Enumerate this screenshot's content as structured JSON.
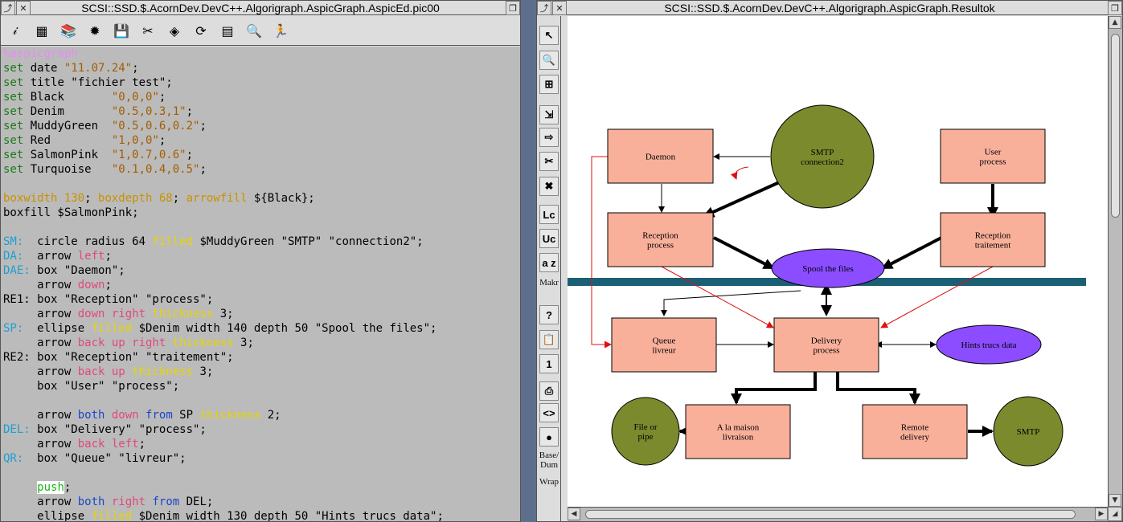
{
  "editor": {
    "title": "SCSI::SSD.$.AcornDev.DevC++.Algorigraph.AspicGraph.AspicEd.pic00",
    "toolbar": [
      {
        "name": "info-icon",
        "glyph": "𝒾"
      },
      {
        "name": "film-icon",
        "glyph": "▦"
      },
      {
        "name": "books-icon",
        "glyph": "📚"
      },
      {
        "name": "gear-icon",
        "glyph": "✹"
      },
      {
        "name": "save-icon",
        "glyph": "💾"
      },
      {
        "name": "pin-icon",
        "glyph": "✂"
      },
      {
        "name": "diamond-icon",
        "glyph": "◈"
      },
      {
        "name": "refresh-icon",
        "glyph": "⟳"
      },
      {
        "name": "chart-icon",
        "glyph": "▤"
      },
      {
        "name": "find-icon",
        "glyph": "🔍"
      },
      {
        "name": "run-icon",
        "glyph": "🏃"
      }
    ],
    "code": [
      [
        [
          "k-head",
          "%aspicgraph"
        ]
      ],
      [
        [
          "k-set",
          "set"
        ],
        [
          "",
          " date "
        ],
        [
          "k-str",
          "\"11.07.24\""
        ],
        [
          "",
          ";"
        ]
      ],
      [
        [
          "k-set",
          "set"
        ],
        [
          "",
          " title \"fichier test\";"
        ]
      ],
      [
        [
          "k-set",
          "set"
        ],
        [
          "",
          " Black       "
        ],
        [
          "k-str",
          "\"0,0,0\""
        ],
        [
          "",
          ";"
        ]
      ],
      [
        [
          "k-set",
          "set"
        ],
        [
          "",
          " Denim       "
        ],
        [
          "k-str",
          "\"0.5,0.3,1\""
        ],
        [
          "",
          ";"
        ]
      ],
      [
        [
          "k-set",
          "set"
        ],
        [
          "",
          " MuddyGreen  "
        ],
        [
          "k-str",
          "\"0.5,0.6,0.2\""
        ],
        [
          "",
          ";"
        ]
      ],
      [
        [
          "k-set",
          "set"
        ],
        [
          "",
          " Red         "
        ],
        [
          "k-str",
          "\"1,0,0\""
        ],
        [
          "",
          ";"
        ]
      ],
      [
        [
          "k-set",
          "set"
        ],
        [
          "",
          " SalmonPink  "
        ],
        [
          "k-str",
          "\"1,0.7,0.6\""
        ],
        [
          "",
          ";"
        ]
      ],
      [
        [
          "k-set",
          "set"
        ],
        [
          "",
          " Turquoise   "
        ],
        [
          "k-str",
          "\"0.1,0.4,0.5\""
        ],
        [
          "",
          ";"
        ]
      ],
      [
        [
          "",
          ""
        ]
      ],
      [
        [
          "k-num",
          "boxwidth 130"
        ],
        [
          "",
          "; "
        ],
        [
          "k-num",
          "boxdepth 68"
        ],
        [
          "",
          "; "
        ],
        [
          "k-num",
          "arrowfill"
        ],
        [
          "",
          " ${Black};"
        ]
      ],
      [
        [
          "",
          "boxfill $SalmonPink;"
        ]
      ],
      [
        [
          "",
          ""
        ]
      ],
      [
        [
          "k-lab",
          "SM:"
        ],
        [
          "",
          "  circle radius 64 "
        ],
        [
          "k-fil",
          "filled"
        ],
        [
          "",
          " $MuddyGreen \"SMTP\" \"connection2\";"
        ]
      ],
      [
        [
          "k-lab",
          "DA:"
        ],
        [
          "",
          "  arrow "
        ],
        [
          "k-dir",
          "left"
        ],
        [
          "",
          ";"
        ]
      ],
      [
        [
          "k-lab",
          "DAE:"
        ],
        [
          "",
          " box \"Daemon\";"
        ]
      ],
      [
        [
          "",
          "     arrow "
        ],
        [
          "k-dir",
          "down"
        ],
        [
          "",
          ";"
        ]
      ],
      [
        [
          "",
          "RE1: box \"Reception\" \"process\";"
        ]
      ],
      [
        [
          "",
          "     arrow "
        ],
        [
          "k-dir",
          "down right"
        ],
        [
          "",
          " "
        ],
        [
          "k-fil",
          "thickness"
        ],
        [
          "",
          " 3;"
        ]
      ],
      [
        [
          "k-lab",
          "SP:"
        ],
        [
          "",
          "  ellipse "
        ],
        [
          "k-fil",
          "filled"
        ],
        [
          "",
          " $Denim width 140 depth 50 \"Spool the files\";"
        ]
      ],
      [
        [
          "",
          "     arrow "
        ],
        [
          "k-dir",
          "back up right"
        ],
        [
          "",
          " "
        ],
        [
          "k-fil",
          "thickness"
        ],
        [
          "",
          " 3;"
        ]
      ],
      [
        [
          "",
          "RE2: box \"Reception\" \"traitement\";"
        ]
      ],
      [
        [
          "",
          "     arrow "
        ],
        [
          "k-dir",
          "back up"
        ],
        [
          "",
          " "
        ],
        [
          "k-fil",
          "thickness"
        ],
        [
          "",
          " 3;"
        ]
      ],
      [
        [
          "",
          "     box \"User\" \"process\";"
        ]
      ],
      [
        [
          "",
          ""
        ]
      ],
      [
        [
          "",
          "     arrow "
        ],
        [
          "k-kw",
          "both"
        ],
        [
          "",
          " "
        ],
        [
          "k-dir",
          "down"
        ],
        [
          "",
          " "
        ],
        [
          "k-kw",
          "from"
        ],
        [
          "",
          " SP "
        ],
        [
          "k-fil",
          "thickness"
        ],
        [
          "",
          " 2;"
        ]
      ],
      [
        [
          "k-lab",
          "DEL:"
        ],
        [
          "",
          " box \"Delivery\" \"process\";"
        ]
      ],
      [
        [
          "",
          "     arrow "
        ],
        [
          "k-dir",
          "back left"
        ],
        [
          "",
          ";"
        ]
      ],
      [
        [
          "k-lab",
          "QR:"
        ],
        [
          "",
          "  box \"Queue\" \"livreur\";"
        ]
      ],
      [
        [
          "",
          ""
        ]
      ],
      [
        [
          "",
          "     "
        ],
        [
          "k-push",
          "push"
        ],
        [
          "",
          ";"
        ]
      ],
      [
        [
          "",
          "     arrow "
        ],
        [
          "k-kw",
          "both"
        ],
        [
          "",
          " "
        ],
        [
          "k-dir",
          "right"
        ],
        [
          "",
          " "
        ],
        [
          "k-kw",
          "from"
        ],
        [
          "",
          " DEL;"
        ]
      ],
      [
        [
          "",
          "     ellipse "
        ],
        [
          "k-fil",
          "filled"
        ],
        [
          "",
          " $Denim width 130 depth 50 \"Hints trucs data\";"
        ]
      ]
    ]
  },
  "result": {
    "title": "SCSI::SSD.$.AcornDev.DevC++.Algorigraph.AspicGraph.Resultok",
    "sidebar": [
      {
        "name": "select-tool-button",
        "glyph": "↖",
        "type": "btn"
      },
      {
        "name": "zoom-in-button",
        "glyph": "🔍",
        "type": "btn"
      },
      {
        "name": "zoom-fit-button",
        "glyph": "⊞",
        "type": "btn"
      },
      {
        "name": "import-button",
        "glyph": "⇲",
        "type": "btn"
      },
      {
        "name": "export-button",
        "glyph": "⇨",
        "type": "btn"
      },
      {
        "name": "cut-button",
        "glyph": "✂",
        "type": "btn"
      },
      {
        "name": "delete-button",
        "glyph": "✖",
        "type": "btn"
      },
      {
        "name": "lowercase-button",
        "glyph": "Lc",
        "type": "btn"
      },
      {
        "name": "uppercase-button",
        "glyph": "Uc",
        "type": "btn"
      },
      {
        "name": "sort-az-button",
        "glyph": "a z",
        "type": "btn"
      },
      {
        "name": "make-label",
        "glyph": "Makr",
        "type": "txt"
      },
      {
        "name": "help-button",
        "glyph": "?",
        "type": "btn"
      },
      {
        "name": "clipboard-button",
        "glyph": "📋",
        "type": "btn"
      },
      {
        "name": "calendar-button",
        "glyph": "1",
        "type": "btn"
      },
      {
        "name": "printer-button",
        "glyph": "⎙",
        "type": "btn"
      },
      {
        "name": "tag-button",
        "glyph": "<>",
        "type": "btn"
      },
      {
        "name": "record-button",
        "glyph": "●",
        "type": "btn"
      },
      {
        "name": "base-dump-label",
        "glyph": "Base/ Dum",
        "type": "txt"
      },
      {
        "name": "wrap-label",
        "glyph": "Wrap",
        "type": "txt"
      }
    ],
    "colors": {
      "salmon": "#f9b09a",
      "green": "#7a8a2d",
      "denim": "#8b4dff",
      "turquoise": "#1b5f75",
      "red": "#e01010"
    },
    "diagram": {
      "nodes": {
        "smtp_conn": [
          "SMTP",
          "connection2"
        ],
        "daemon": [
          "Daemon"
        ],
        "user": [
          "User",
          "process"
        ],
        "reception1": [
          "Reception",
          "process"
        ],
        "reception2": [
          "Reception",
          "traitement"
        ],
        "spool": [
          "Spool the files"
        ],
        "queue": [
          "Queue",
          "livreur"
        ],
        "delivery": [
          "Delivery",
          "process"
        ],
        "hints": [
          "Hints trucs data"
        ],
        "filepipe": [
          "File or",
          "pipe"
        ],
        "alamaison": [
          "A la maison",
          "livraison"
        ],
        "remote": [
          "Remote",
          "delivery"
        ],
        "smtp": [
          "SMTP"
        ]
      }
    }
  }
}
